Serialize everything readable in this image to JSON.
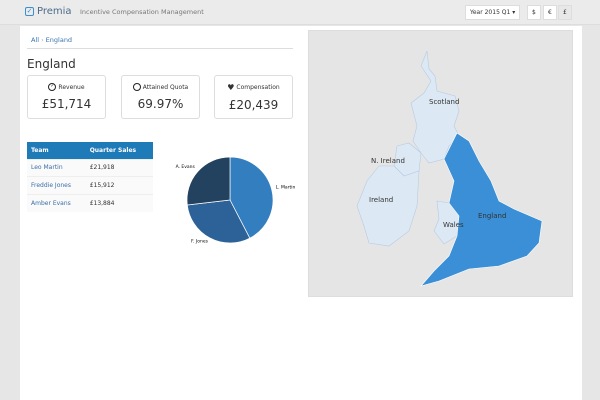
{
  "header": {
    "brand": "Premia",
    "app_title": "Incentive Compensation Management",
    "period": "Year 2015 Q1",
    "currencies": [
      "$",
      "€",
      "£"
    ],
    "active_currency": "£"
  },
  "breadcrumb": [
    "All",
    "England"
  ],
  "page_title": "England",
  "kpis": [
    {
      "icon": "check-circle-icon",
      "label": "Revenue",
      "value": "£51,714"
    },
    {
      "icon": "gauge-icon",
      "label": "Attained Quota",
      "value": "69.97%"
    },
    {
      "icon": "heart-icon",
      "label": "Compensation",
      "value": "£20,439"
    }
  ],
  "table": {
    "headers": [
      "Team",
      "Quarter Sales"
    ],
    "rows": [
      [
        "Leo Martin",
        "£21,918"
      ],
      [
        "Freddie Jones",
        "£15,912"
      ],
      [
        "Amber Evans",
        "£13,884"
      ]
    ]
  },
  "chart_data": {
    "type": "pie",
    "categories": [
      "L. Martin",
      "F. Jones",
      "A. Evans"
    ],
    "values": [
      21918,
      15912,
      13884
    ],
    "colors": [
      "#337ebf",
      "#2d6299",
      "#23425f"
    ]
  },
  "map": {
    "regions": [
      "Scotland",
      "N. Ireland",
      "Ireland",
      "Wales",
      "England"
    ],
    "selected": "England",
    "selected_color": "#3a8fd6",
    "default_color": "#dce9f5"
  }
}
